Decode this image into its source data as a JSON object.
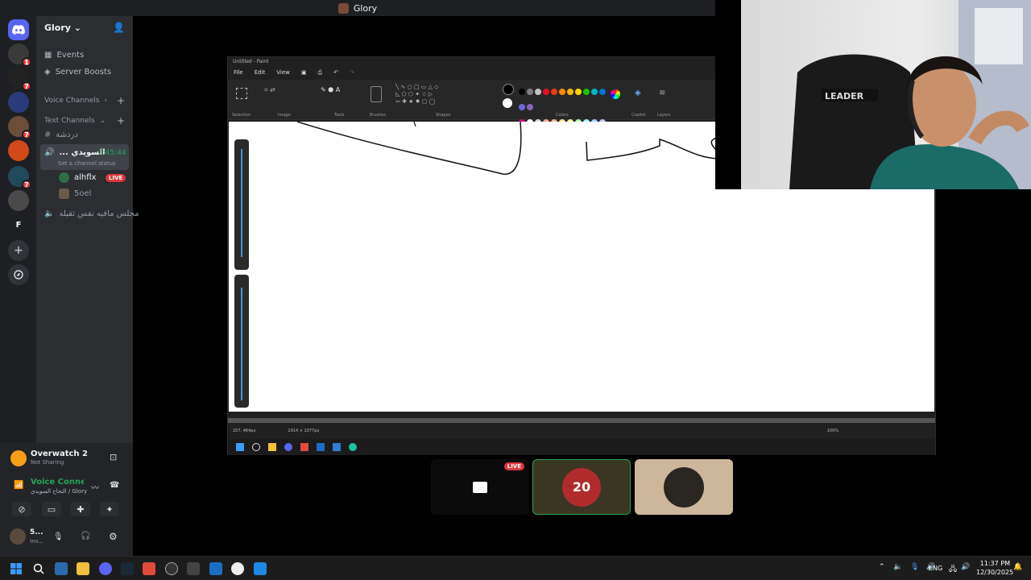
{
  "top_title": "Glory",
  "server": {
    "name": "Glory",
    "events": "Events",
    "boosts": "Server Boosts",
    "voice_category": "Voice Channels",
    "text_category": "Text Channels",
    "text_channel": "دردشة",
    "voice_channel": {
      "name": "... السويدي",
      "timer": "2:45:44",
      "status": "Set a channel status"
    },
    "members": [
      {
        "name": "alhflx",
        "live": "LIVE"
      },
      {
        "name": "5oel"
      }
    ],
    "other_voice": "مجلس مافيه نفس ثقيله"
  },
  "rail_badges": [
    "1",
    "7",
    "7",
    "7"
  ],
  "rail_labels": {
    "f": "F"
  },
  "activity": {
    "game": "Overwatch 2",
    "sub": "Not Sharing"
  },
  "voice_conn": {
    "title": "Voice Connecte",
    "sub": "التجاح السويدي / Glory"
  },
  "user": {
    "name": "5...",
    "status": "Inv..."
  },
  "paint": {
    "title": "Untitled - Paint",
    "menus": [
      "File",
      "Edit",
      "View"
    ],
    "groups": [
      "Selection",
      "Image",
      "Tools",
      "Brushes",
      "Shapes",
      "Colors",
      "Copilot",
      "Layers"
    ],
    "palette": [
      "#000000",
      "#7f7f7f",
      "#c3c3c3",
      "#e81123",
      "#f03a17",
      "#ff8c00",
      "#ffb900",
      "#ffd800",
      "#16c60c",
      "#00b7c3",
      "#0078d4",
      "#6b69d6",
      "#8764b8",
      "#e3008c",
      "#ffffff",
      "#dddddd",
      "#ff9e9e",
      "#ffb785",
      "#ffe79e",
      "#fff4a3",
      "#b4ffb3",
      "#a6f5ff",
      "#9fd4ff",
      "#c4c2f2",
      "#d9c3ef"
    ],
    "status_pos": "207, 464px",
    "status_size": "1914 × 1077px",
    "zoom": "100%"
  },
  "stream_tile": {
    "live": "LIVE"
  },
  "taskbar": {
    "lang": "ENG",
    "time": "11:37 PM",
    "date": "12/30/2025"
  }
}
